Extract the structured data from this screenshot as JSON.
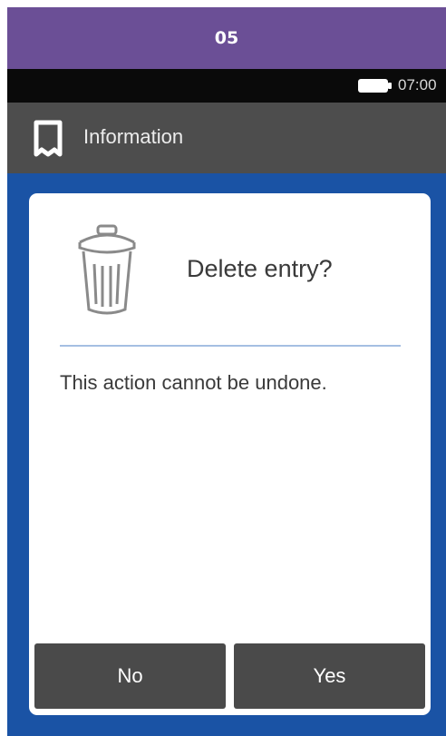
{
  "step_banner": {
    "number": "05",
    "color": "#6b4f96"
  },
  "status_bar": {
    "battery_icon": "battery-icon",
    "time": "07:00"
  },
  "title_bar": {
    "icon": "receipt-icon",
    "title": "Information"
  },
  "dialog": {
    "icon": "trash-icon",
    "title": "Delete entry?",
    "message": "This action cannot be undone.",
    "buttons": {
      "no_label": "No",
      "yes_label": "Yes"
    }
  },
  "colors": {
    "background_blue": "#1a53a5",
    "title_bar": "#4d4d4d",
    "button": "#4a4a4a",
    "divider": "#a5bfe2"
  }
}
